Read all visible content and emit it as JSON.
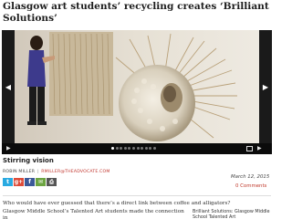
{
  "article": {
    "headline": "Glasgow art students’ recycling creates ‘Brilliant Solutions’",
    "caption": "Stirring vision",
    "author": "ROBIN MILLER",
    "author_email": "RMILLER@THEADVOCATE.COM",
    "date": "March 12, 2015",
    "comments_link": "0 Comments",
    "lede": "Who would have ever guessed that there’s a direct link between coffee and alligators?",
    "paragraph2": "Glasgow Middle School’s Talented Art students made the connection in",
    "related_link": "Brilliant Solutions: Glasgow Middle School Talented Art"
  },
  "gallery": {
    "prev_icon": "chevron-left-icon",
    "next_icon": "chevron-right-icon",
    "play_icon": "play-icon",
    "fullscreen_icon": "fullscreen-icon",
    "slide_count": 11,
    "active_slide": 1
  },
  "share": {
    "buttons": [
      {
        "name": "twitter",
        "icon": "twitter-icon",
        "glyph": "t",
        "color": "#29aae1"
      },
      {
        "name": "google-plus",
        "icon": "google-plus-icon",
        "glyph": "g+",
        "color": "#dd4b39"
      },
      {
        "name": "facebook",
        "icon": "facebook-icon",
        "glyph": "f",
        "color": "#3b5998"
      },
      {
        "name": "email",
        "icon": "email-icon",
        "glyph": "✉",
        "color": "#6ca441"
      },
      {
        "name": "print",
        "icon": "print-icon",
        "glyph": "⎙",
        "color": "#555555"
      }
    ]
  },
  "colors": {
    "link": "#c0332b",
    "gallery_bg": "#111111"
  }
}
